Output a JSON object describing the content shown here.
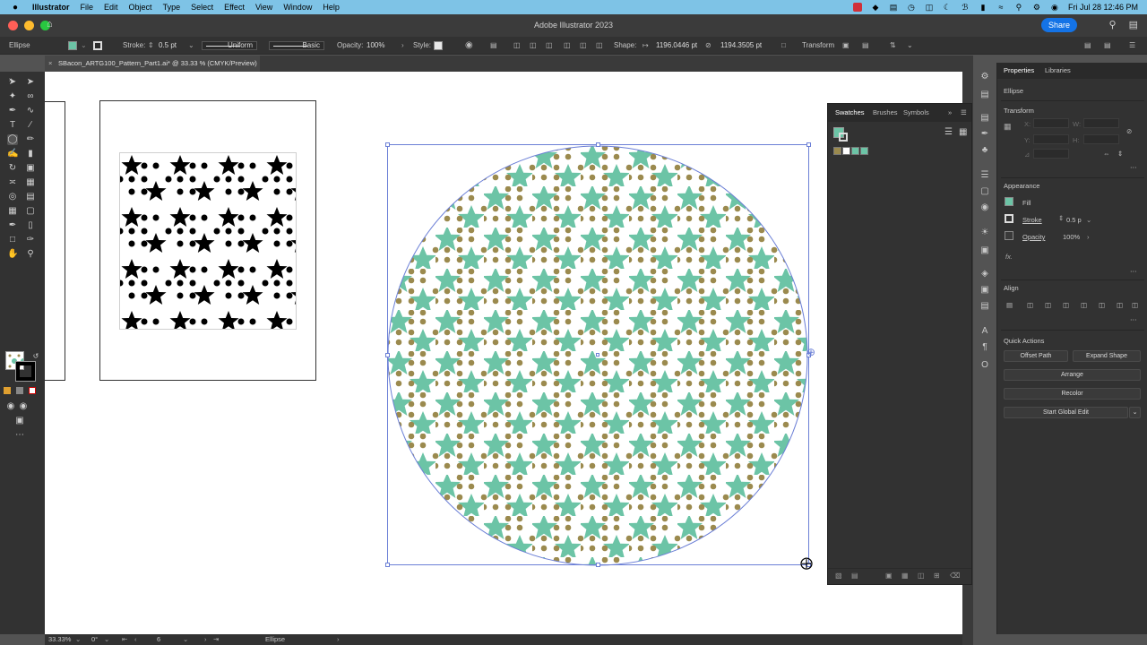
{
  "menubar": {
    "app": "Illustrator",
    "items": [
      "File",
      "Edit",
      "Object",
      "Type",
      "Select",
      "Effect",
      "View",
      "Window",
      "Help"
    ],
    "clock": "Fri Jul 28  12:46 PM"
  },
  "titlebar": {
    "title": "Adobe Illustrator 2023",
    "share": "Share"
  },
  "control": {
    "selection": "Ellipse",
    "stroke_label": "Stroke:",
    "stroke_value": "0.5 pt",
    "profile1": "Uniform",
    "profile2": "Basic",
    "opacity_label": "Opacity:",
    "opacity_value": "100%",
    "style_label": "Style:",
    "shape_label": "Shape:",
    "width_value": "1196.0446 pt",
    "height_value": "1194.3505 pt",
    "transform": "Transform"
  },
  "document": {
    "tab": "SBacon_ARTG100_Pattern_Part1.ai* @ 33.33 % (CMYK/Preview)"
  },
  "status": {
    "zoom": "33.33%",
    "rotation": "0°",
    "artboard": "6",
    "tool": "Ellipse"
  },
  "swatches": {
    "tabs": [
      "Swatches",
      "Brushes",
      "Symbols"
    ]
  },
  "properties": {
    "tabs": [
      "Properties",
      "Libraries"
    ],
    "kind": "Ellipse",
    "transform_title": "Transform",
    "x_label": "X:",
    "y_label": "Y:",
    "w_label": "W:",
    "h_label": "H:",
    "angle_label": "⊿",
    "appearance_title": "Appearance",
    "fill_label": "Fill",
    "stroke_label": "Stroke",
    "stroke_value": "0.5 p",
    "opacity_label": "Opacity",
    "opacity_value": "100%",
    "fx_label": "fx.",
    "align_title": "Align",
    "quick_actions_title": "Quick Actions",
    "buttons": {
      "offset_path": "Offset Path",
      "expand_shape": "Expand Shape",
      "arrange": "Arrange",
      "recolor": "Recolor",
      "global_edit": "Start Global Edit"
    }
  },
  "colors": {
    "pattern_star": "#6cc4a6",
    "pattern_dot": "#9b8a4e",
    "selection": "#6b7fd6"
  }
}
